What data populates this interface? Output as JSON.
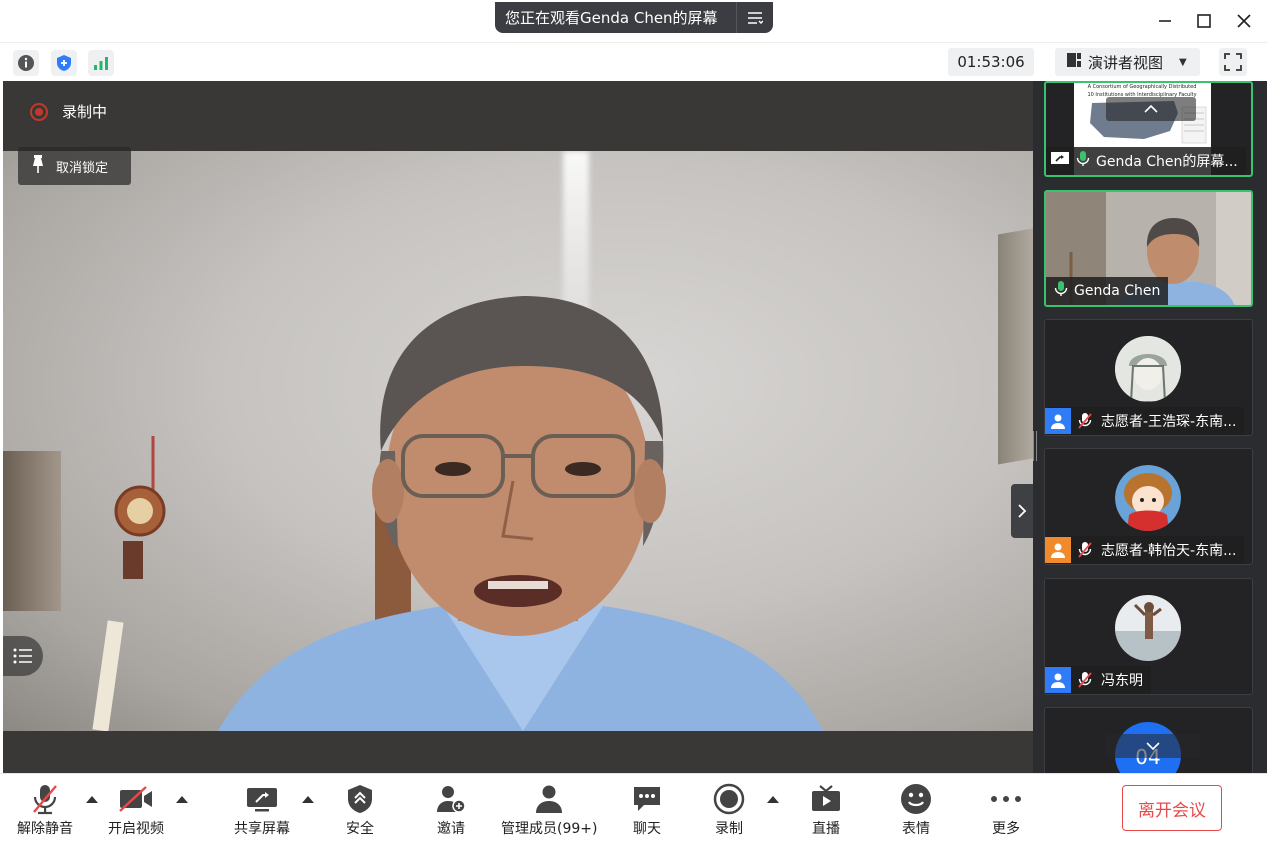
{
  "titlebar": {
    "share_banner": "您正在观看Genda Chen的屏幕"
  },
  "infobar": {
    "timer": "01:53:06",
    "view_label": "演讲者视图"
  },
  "stage": {
    "recording_label": "录制中",
    "unpin_label": "取消锁定"
  },
  "sidebar": {
    "screen_tile": {
      "name": "Genda Chen的屏幕...",
      "slide_title_line1": "A Consortium of Geographically Distributed",
      "slide_title_line2": "10 Institutions with Interdisciplinary Faculty"
    },
    "video_tile": {
      "name": "Genda Chen"
    },
    "participants": [
      {
        "name": "志愿者-王浩琛-东南...",
        "badge_color": "#2f7cf6"
      },
      {
        "name": "志愿者-韩怡天-东南...",
        "badge_color": "#f08a2c"
      },
      {
        "name": "冯东明",
        "badge_color": "#2f7cf6"
      }
    ],
    "last_tile_avatar_text": "04"
  },
  "toolbar": {
    "unmute": "解除静音",
    "start_video": "开启视频",
    "share_screen": "共享屏幕",
    "security": "安全",
    "invite": "邀请",
    "manage_members": "管理成员(99+)",
    "chat": "聊天",
    "record": "录制",
    "live": "直播",
    "reactions": "表情",
    "more": "更多",
    "leave": "离开会议"
  },
  "colors": {
    "active_border": "#37c46d",
    "leave_red": "#e84a4a",
    "record_red": "#c0392b",
    "badge_blue": "#2f7cf6"
  }
}
